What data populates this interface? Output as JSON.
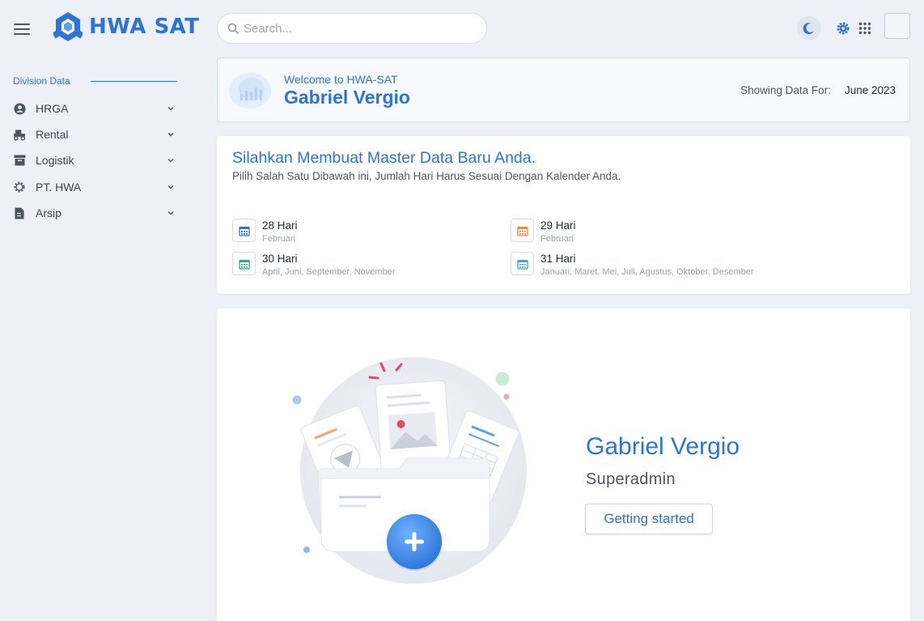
{
  "brand": {
    "name": "HWA SAT"
  },
  "search": {
    "placeholder": "Search..."
  },
  "header_icons": [
    "menu-icon",
    "moon-icon",
    "gear-icon",
    "apps-grid-icon",
    "avatar"
  ],
  "sidebar": {
    "section_title": "Division Data",
    "items": [
      {
        "label": "HRGA",
        "icon": "user-circle-icon"
      },
      {
        "label": "Rental",
        "icon": "truck-icon"
      },
      {
        "label": "Logistik",
        "icon": "archive-box-icon"
      },
      {
        "label": "PT. HWA",
        "icon": "gear-outline-icon"
      },
      {
        "label": "Arsip",
        "icon": "document-icon"
      }
    ]
  },
  "welcome": {
    "subtitle": "Welcome to HWA-SAT",
    "name": "Gabriel Vergio",
    "showing_label": "Showing Data For:",
    "showing_value": "June 2023"
  },
  "master": {
    "title": "Silahkan Membuat Master Data Baru Anda.",
    "subtitle": "Pilih Salah Satu Dibawah ini, Jumlah Hari Harus Sesuai Dengan Kalender Anda.",
    "options": [
      {
        "title": "28 Hari",
        "desc": "Februari",
        "color": "#2c74d6"
      },
      {
        "title": "29 Hari",
        "desc": "Februari",
        "color": "#f08a3c"
      },
      {
        "title": "30 Hari",
        "desc": "April, Juni, September, November",
        "color": "#22b07d"
      },
      {
        "title": "31 Hari",
        "desc": "Januari, Maret, Mei, Juli, Agustus, Oktober, Desember",
        "color": "#3aa8d8"
      }
    ]
  },
  "hero": {
    "name": "Gabriel Vergio",
    "role": "Superadmin",
    "button": "Getting started"
  },
  "colors": {
    "accent": "#2c74d6",
    "background": "#edf1f7"
  }
}
